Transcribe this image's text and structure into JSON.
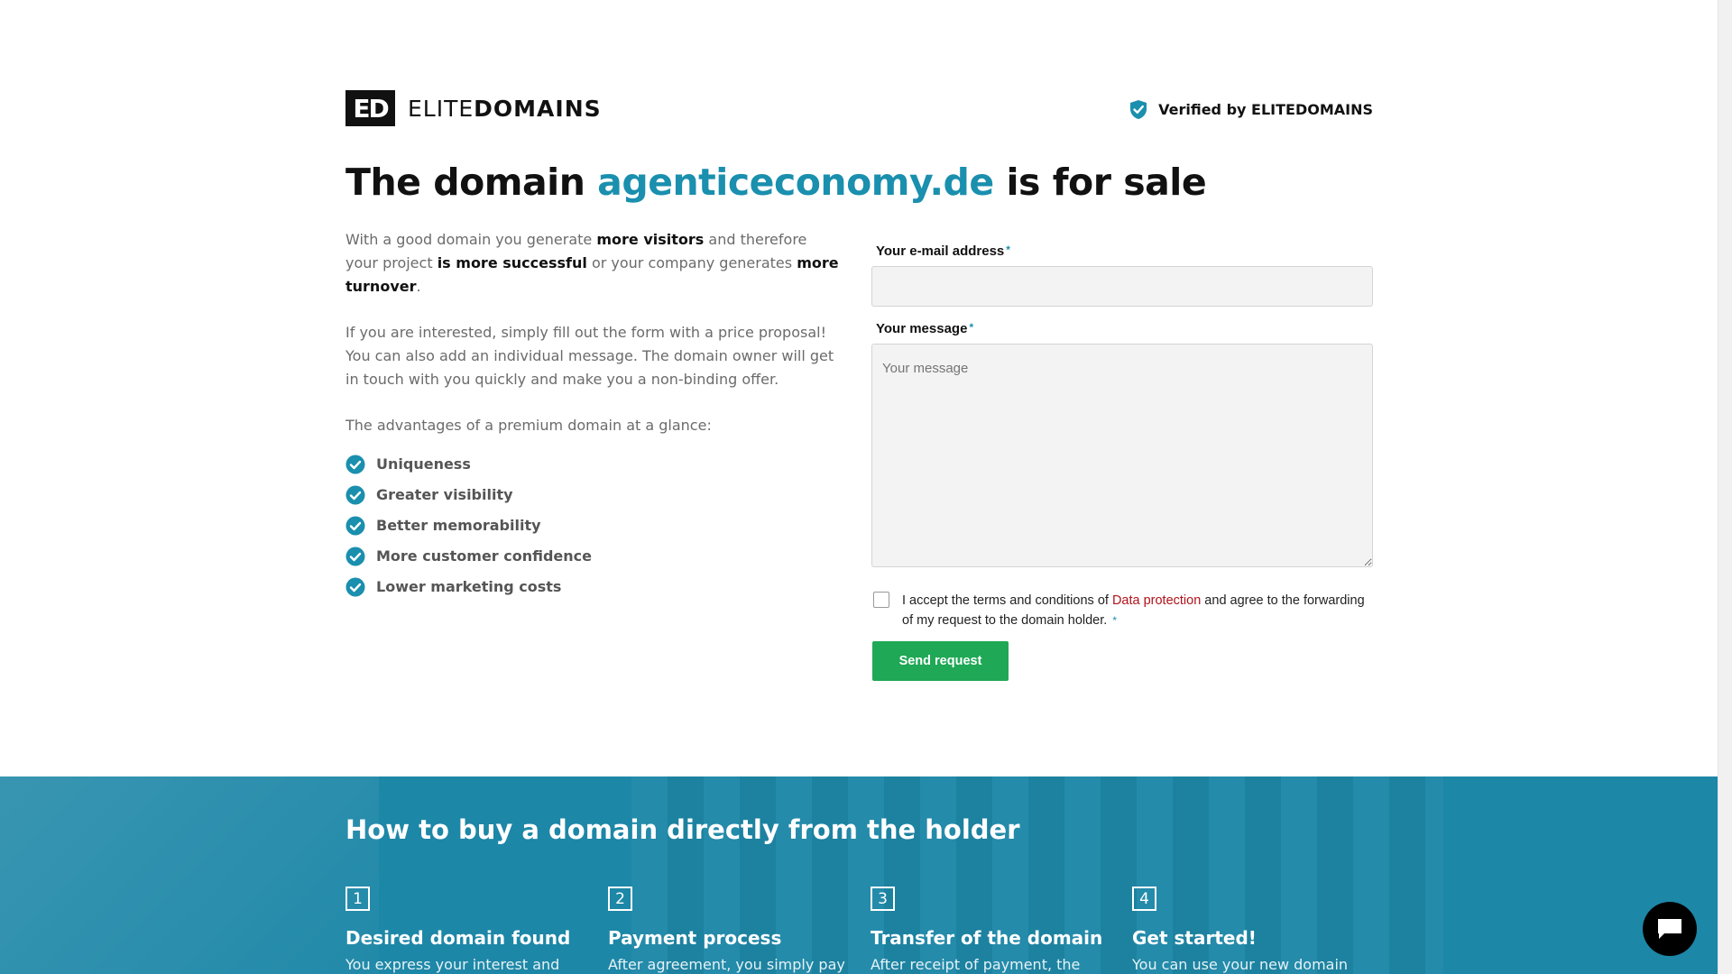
{
  "header": {
    "logo_mark": "ED",
    "logo_text_light": "ELITE",
    "logo_text_bold": "DOMAINS",
    "verified": "Verified by ELITEDOMAINS"
  },
  "hero": {
    "title_before": "The domain",
    "domain": "agenticeconomy.de",
    "title_after": "is for sale"
  },
  "intro": {
    "p1_a": "With a good domain you generate ",
    "p1_b": "more visitors",
    "p1_c": " and therefore your project ",
    "p1_d": "is more successful",
    "p1_e": " or your company generates ",
    "p1_f": "more turnover",
    "p1_g": ".",
    "p2": "If you are interested, simply fill out the form with a price proposal! You can also add an individual message. The domain owner will get in touch with you quickly and make you a non-binding offer.",
    "p3": "The advantages of a premium domain at a glance:",
    "advantages": [
      "Uniqueness",
      "Greater visibility",
      "Better memorability",
      "More customer confidence",
      "Lower marketing costs"
    ]
  },
  "form": {
    "email_label": "Your e-mail address",
    "required_mark": "*",
    "email_value": "",
    "message_label": "Your message",
    "message_placeholder": "Your message",
    "terms_a": "I accept the terms and conditions of ",
    "terms_link": "Data protection",
    "terms_b": " and agree to the forwarding of my request to the domain holder.",
    "send_label": "Send request"
  },
  "howto": {
    "heading": "How to buy a domain directly from the holder",
    "steps": [
      {
        "num": "1",
        "title": "Desired domain found",
        "desc": "You express your interest and"
      },
      {
        "num": "2",
        "title": "Payment process",
        "desc": "After agreement, you simply pay"
      },
      {
        "num": "3",
        "title": "Transfer of the domain",
        "desc": "After receipt of payment, the"
      },
      {
        "num": "4",
        "title": "Get started!",
        "desc": "You can use your new domain"
      }
    ]
  },
  "colors": {
    "accent": "#1a8fae",
    "button": "#1fa855",
    "link": "#b0121b",
    "band": "#1d87a7"
  },
  "icons": {
    "verified": "shield-check-icon",
    "advantage": "check-circle-icon",
    "chat": "chat-bubble-icon"
  }
}
